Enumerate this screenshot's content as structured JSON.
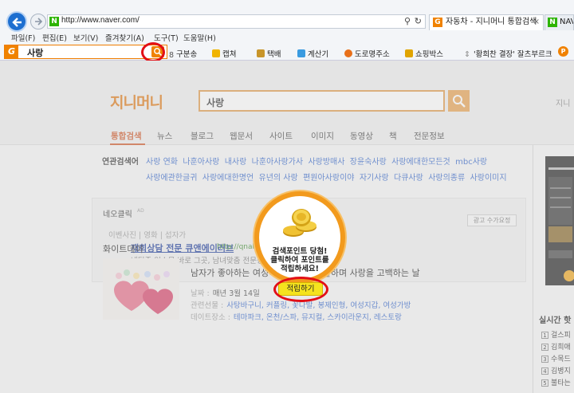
{
  "browser": {
    "url": "http://www.naver.com/",
    "tabs": [
      {
        "label": "자동차 - 지니머니 통합검색",
        "active": true
      },
      {
        "label": "NAV",
        "active": false
      }
    ],
    "menu": [
      "파일(F)",
      "편집(E)",
      "보기(V)",
      "즐겨찾기(A)",
      "도구(T)",
      "도움말(H)"
    ]
  },
  "toolbar": {
    "search_query": "사랑",
    "items": [
      "구분송",
      "캡쳐",
      "택배",
      "계산기",
      "도로명주소",
      "쇼핑박스",
      "'황희찬 결장' 잘츠부르크"
    ],
    "accent": "#f08200"
  },
  "page": {
    "logo": "지니머니",
    "search_query": "사랑",
    "header_right": "지니",
    "nav_tabs": [
      "통합검색",
      "뉴스",
      "블로그",
      "웹문서",
      "사이트",
      "이미지",
      "동영상",
      "책",
      "전문정보"
    ],
    "related": {
      "label": "연관검색어",
      "line1": [
        "사랑 연화",
        "나훈아사랑",
        "내사랑",
        "나훈아사랑가사",
        "사랑방매사",
        "장윤숙사랑",
        "사랑에대한모든것",
        "mbc사랑"
      ],
      "line2": [
        "사랑에관한글귀",
        "사랑에대한명언",
        "유년의 사랑",
        "편원아사랑이야",
        "자기사랑",
        "다큐사랑",
        "사랑의종류",
        "사랑이미지"
      ]
    },
    "neoclick": {
      "title": "네오클릭",
      "ad_tag": "AD",
      "ad_button": "광고 수가요정",
      "category": "이벤사진 | 영화 | 섭자가",
      "link": "재회상담 전문 큐앤에이러브",
      "url": "http://qnalov",
      "desc": "네티즌 입소문 바로 그곳, 남녀맞춤 전문상담사,"
    },
    "white": {
      "title": "화이트데이",
      "headline": "남자가 좋아하는 여성에게 사탕을 선물하며 사랑을 고백하는 날",
      "date_label": "날짜 :",
      "date_value": "매년 3월 14일",
      "gift_label": "관련선물 :",
      "gift_value": "사탕바구니, 커플링, 꽃다발, 봉제인형, 여성지갑, 여성가방",
      "place_label": "데이트장소 :",
      "place_value": "테마파크, 온천/스파, 뮤지컬, 스카이라운지, 레스토랑"
    },
    "realtime": {
      "title": "실시간 핫",
      "items": [
        "걸스피",
        "김희애",
        "수목드",
        "김병지",
        "불타는"
      ]
    }
  },
  "popup": {
    "text": [
      "검색포인트 당첨!",
      "클릭하여 포인트를",
      "적립하세요!"
    ],
    "button": "적립하기"
  },
  "annotation_color": "#e20f16"
}
